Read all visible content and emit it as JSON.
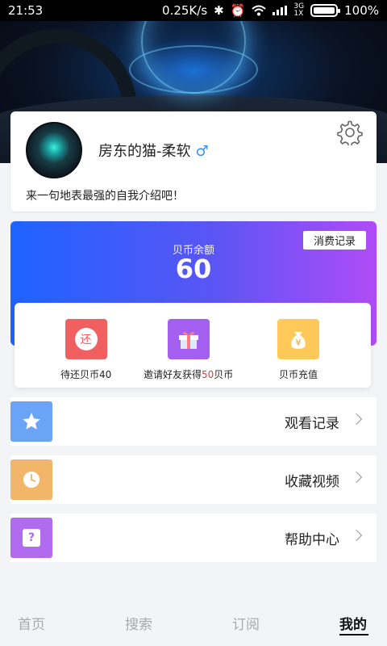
{
  "status_bar": {
    "time": "21:53",
    "speed": "0.25K/s",
    "net_top": "3G",
    "net_bottom": "1X",
    "battery": "100%"
  },
  "profile": {
    "username": "房东的猫-柔软",
    "gender_symbol": "♂",
    "bio": "来一句地表最强的自我介绍吧！"
  },
  "balance": {
    "label": "贝币余额",
    "value": "60",
    "records_button": "消费记录"
  },
  "actions": [
    {
      "label": "待还贝币40",
      "icon": "repay-icon",
      "icon_char": "还",
      "color": "#f06060"
    },
    {
      "label_prefix": "邀请好友获得",
      "label_highlight": "50",
      "label_suffix": "贝币",
      "icon": "gift-icon",
      "color": "#a45ff0"
    },
    {
      "label": "贝币充值",
      "icon": "money-bag-icon",
      "icon_char": "¥",
      "color": "#ffc95a"
    }
  ],
  "menu": [
    {
      "label": "观看记录",
      "icon": "star-icon",
      "color": "#6aa4f7"
    },
    {
      "label": "收藏视频",
      "icon": "clock-icon",
      "color": "#f2b66b"
    },
    {
      "label": "帮助中心",
      "icon": "help-icon",
      "icon_char": "?",
      "color": "#b06bef"
    }
  ],
  "tabs": [
    {
      "label": "首页",
      "active": false
    },
    {
      "label": "搜索",
      "active": false
    },
    {
      "label": "订阅",
      "active": false
    },
    {
      "label": "我的",
      "active": true
    }
  ]
}
